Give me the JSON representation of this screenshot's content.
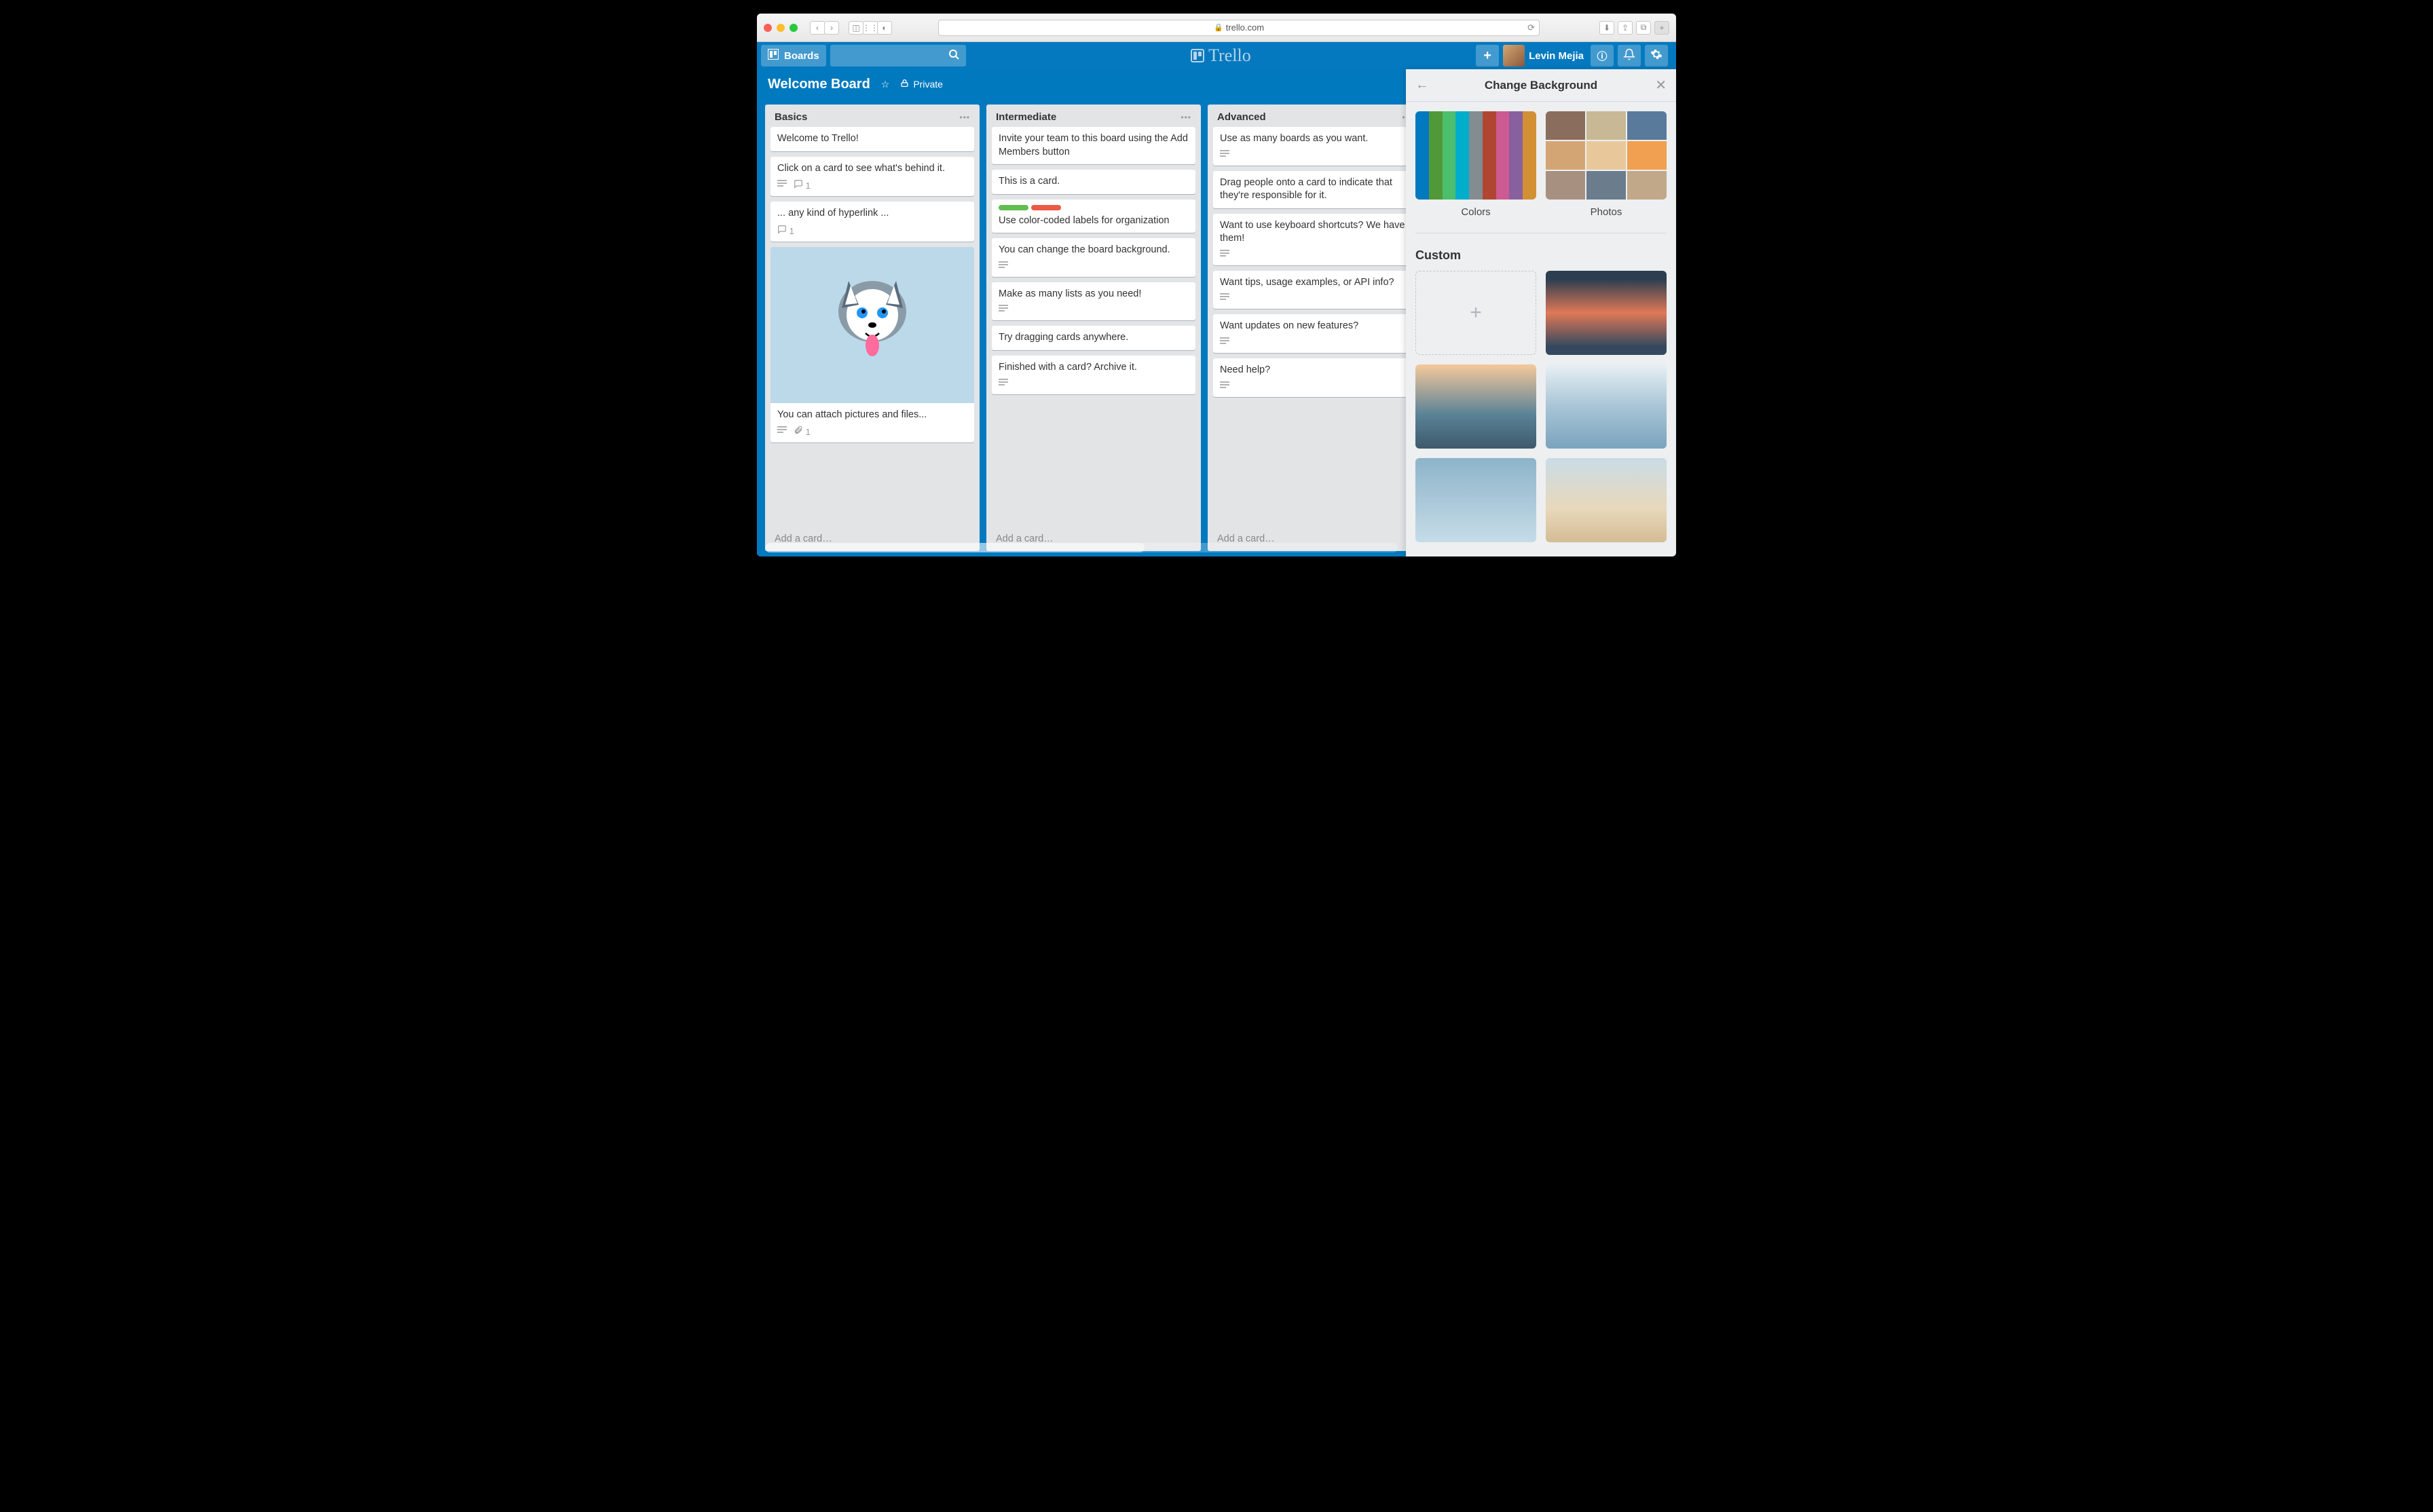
{
  "browser": {
    "url": "trello.com"
  },
  "header": {
    "boards_label": "Boards",
    "logo_text": "Trello",
    "user_name": "Levin Mejia"
  },
  "board": {
    "title": "Welcome Board",
    "visibility": "Private"
  },
  "lists": [
    {
      "title": "Basics",
      "cards": [
        {
          "text": "Welcome to Trello!"
        },
        {
          "text": "Click on a card to see what's behind it.",
          "desc": true,
          "comments": 1
        },
        {
          "text": "... any kind of hyperlink ...",
          "comments": 1
        },
        {
          "text": "You can attach pictures and files...",
          "desc": true,
          "attachments": 1,
          "image": true
        }
      ],
      "add_label": "Add a card…"
    },
    {
      "title": "Intermediate",
      "cards": [
        {
          "text": "Invite your team to this board using the Add Members button"
        },
        {
          "text": "This is a card."
        },
        {
          "text": "Use color-coded labels for organization",
          "labels": [
            "#61bd4f",
            "#eb5a46"
          ]
        },
        {
          "text": "You can change the board background.",
          "desc": true
        },
        {
          "text": "Make as many lists as you need!",
          "desc": true
        },
        {
          "text": "Try dragging cards anywhere."
        },
        {
          "text": "Finished with a card? Archive it.",
          "desc": true
        }
      ],
      "add_label": "Add a card…"
    },
    {
      "title": "Advanced",
      "cards": [
        {
          "text": "Use as many boards as you want.",
          "desc": true
        },
        {
          "text": "Drag people onto a card to indicate that they're responsible for it."
        },
        {
          "text": "Want to use keyboard shortcuts? We have them!",
          "desc": true
        },
        {
          "text": "Want tips, usage examples, or API info?",
          "desc": true
        },
        {
          "text": "Want updates on new features?",
          "desc": true
        },
        {
          "text": "Need help?",
          "desc": true
        }
      ],
      "add_label": "Add a card…"
    }
  ],
  "drawer": {
    "title": "Change Background",
    "colors_label": "Colors",
    "photos_label": "Photos",
    "custom_label": "Custom",
    "color_swatches": [
      "#0079bf",
      "#519839",
      "#4bbf6b",
      "#00aecc",
      "#838c91",
      "#b04632",
      "#cd5a91",
      "#89609e",
      "#d29034"
    ],
    "custom_backgrounds": [
      "linear-gradient(#2c3e50 10%,#e07856 50%,#34495e 90%)",
      "linear-gradient(#f5c99b 0%,#5a8296 60%,#3d5a6c 100%)",
      "linear-gradient(#e8f0f4 0%,#a8c5d6 50%,#7ba3bd 100%)",
      "linear-gradient(#8db4c9 0%,#c5dce8 100%)",
      "linear-gradient(#c9dce6 0%,#e8d8bc 60%,#d4bc94 100%)"
    ]
  }
}
